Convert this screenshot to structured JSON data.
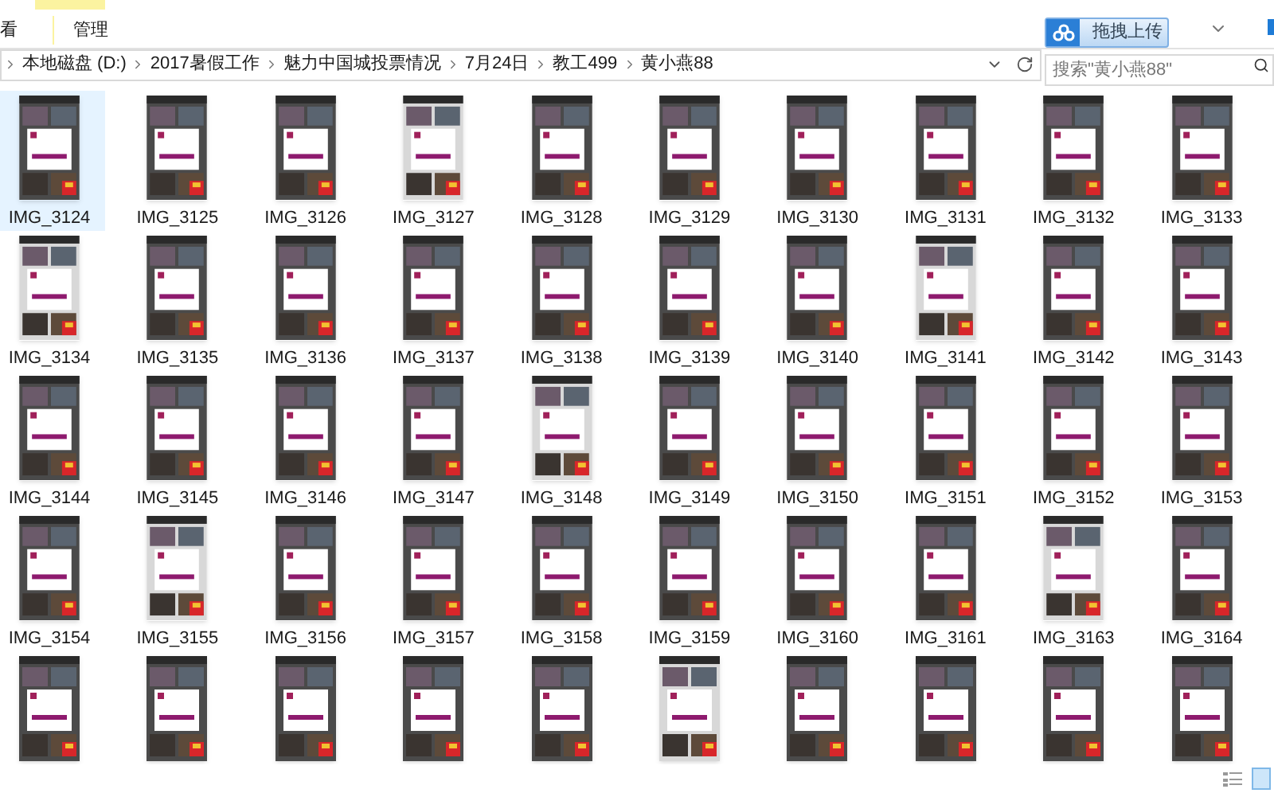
{
  "ribbon_tabs": [
    {
      "label": "看",
      "selected": false
    },
    {
      "label": "管理",
      "selected": false
    }
  ],
  "breadcrumb": [
    "本地磁盘 (D:)",
    "2017暑假工作",
    "魅力中国城投票情况",
    "7月24日",
    "教工499",
    "黄小燕88"
  ],
  "search": {
    "placeholder": "搜索\"黄小燕88\""
  },
  "upload_button": {
    "label": "拖拽上传"
  },
  "files": [
    {
      "name": "IMG_3124",
      "selected": true
    },
    {
      "name": "IMG_3125",
      "selected": false
    },
    {
      "name": "IMG_3126",
      "selected": false
    },
    {
      "name": "IMG_3127",
      "selected": false
    },
    {
      "name": "IMG_3128",
      "selected": false
    },
    {
      "name": "IMG_3129",
      "selected": false
    },
    {
      "name": "IMG_3130",
      "selected": false
    },
    {
      "name": "IMG_3131",
      "selected": false
    },
    {
      "name": "IMG_3132",
      "selected": false
    },
    {
      "name": "IMG_3133",
      "selected": false
    },
    {
      "name": "IMG_3134",
      "selected": false
    },
    {
      "name": "IMG_3135",
      "selected": false
    },
    {
      "name": "IMG_3136",
      "selected": false
    },
    {
      "name": "IMG_3137",
      "selected": false
    },
    {
      "name": "IMG_3138",
      "selected": false
    },
    {
      "name": "IMG_3139",
      "selected": false
    },
    {
      "name": "IMG_3140",
      "selected": false
    },
    {
      "name": "IMG_3141",
      "selected": false
    },
    {
      "name": "IMG_3142",
      "selected": false
    },
    {
      "name": "IMG_3143",
      "selected": false
    },
    {
      "name": "IMG_3144",
      "selected": false
    },
    {
      "name": "IMG_3145",
      "selected": false
    },
    {
      "name": "IMG_3146",
      "selected": false
    },
    {
      "name": "IMG_3147",
      "selected": false
    },
    {
      "name": "IMG_3148",
      "selected": false
    },
    {
      "name": "IMG_3149",
      "selected": false
    },
    {
      "name": "IMG_3150",
      "selected": false
    },
    {
      "name": "IMG_3151",
      "selected": false
    },
    {
      "name": "IMG_3152",
      "selected": false
    },
    {
      "name": "IMG_3153",
      "selected": false
    },
    {
      "name": "IMG_3154",
      "selected": false
    },
    {
      "name": "IMG_3155",
      "selected": false
    },
    {
      "name": "IMG_3156",
      "selected": false
    },
    {
      "name": "IMG_3157",
      "selected": false
    },
    {
      "name": "IMG_3158",
      "selected": false
    },
    {
      "name": "IMG_3159",
      "selected": false
    },
    {
      "name": "IMG_3160",
      "selected": false
    },
    {
      "name": "IMG_3161",
      "selected": false
    },
    {
      "name": "IMG_3163",
      "selected": false
    },
    {
      "name": "IMG_3164",
      "selected": false
    },
    {
      "selected": false
    },
    {
      "selected": false
    },
    {
      "selected": false
    },
    {
      "selected": false
    },
    {
      "selected": false
    },
    {
      "selected": false
    },
    {
      "selected": false
    },
    {
      "selected": false
    },
    {
      "selected": false
    },
    {
      "selected": false
    }
  ]
}
